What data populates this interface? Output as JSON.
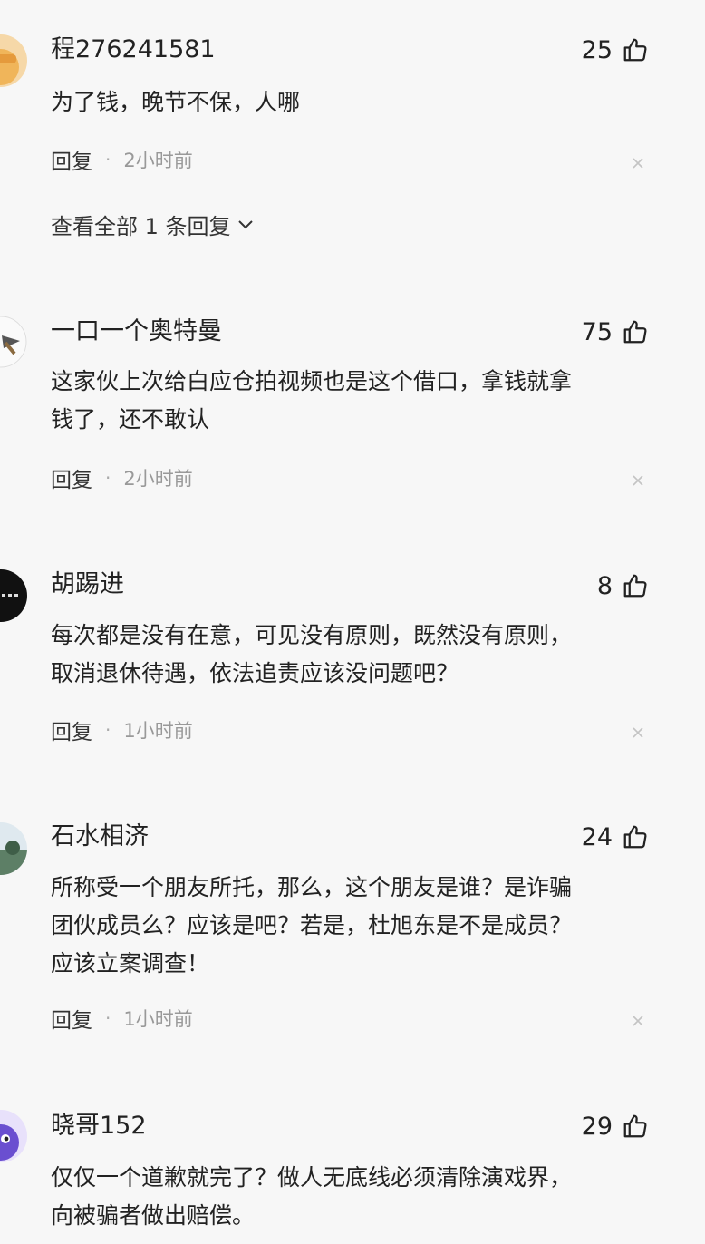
{
  "comments": [
    {
      "username": "程276241581",
      "likes": "25",
      "lines": [
        "为了钱，晚节不保，人哪"
      ],
      "reply_label": "回复",
      "time": "2小时前",
      "view_replies": "查看全部 1 条回复",
      "avatar_color": "#f0b55a"
    },
    {
      "username": "一口一个奥特曼",
      "likes": "75",
      "lines": [
        "这家伙上次给白应仓拍视频也是这个借口，拿钱就拿",
        "钱了，还不敢认"
      ],
      "reply_label": "回复",
      "time": "2小时前",
      "avatar_color": "#e6e6e6"
    },
    {
      "username": "胡踢进",
      "likes": "8",
      "lines": [
        "每次都是没有在意，可见没有原则，既然没有原则，",
        "取消退休待遇，依法追责应该没问题吧？"
      ],
      "reply_label": "回复",
      "time": "1小时前",
      "avatar_color": "#111111"
    },
    {
      "username": "石水相济",
      "likes": "24",
      "lines": [
        "所称受一个朋友所托，那么，这个朋友是谁？是诈骗",
        "团伙成员么？应该是吧？若是，杜旭东是不是成员？",
        "应该立案调查！"
      ],
      "reply_label": "回复",
      "time": "1小时前",
      "avatar_color": "#6f8f7a"
    },
    {
      "username": "晓哥152",
      "likes": "29",
      "lines": [
        "仅仅一个道歉就完了？做人无底线必须清除演戏界，",
        "向被骗者做出赔偿。"
      ],
      "avatar_color": "#6a4fd0"
    }
  ]
}
